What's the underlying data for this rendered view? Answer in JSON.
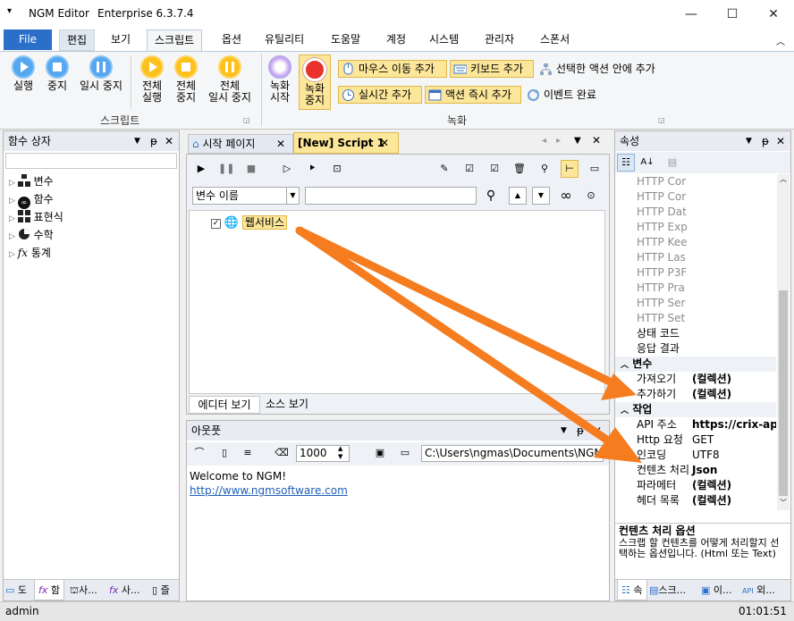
{
  "window": {
    "app_title": "NGM Editor",
    "edition": "Enterprise 6.3.7.4"
  },
  "ribbon_tabs": [
    "File",
    "편집",
    "보기",
    "스크립트",
    "옵션",
    "유틸리티",
    "도움말",
    "계정",
    "시스템",
    "관리자",
    "스폰서"
  ],
  "script_group": {
    "run": "실행",
    "stop": "중지",
    "pause": "일시 중지",
    "all_run_1": "전체",
    "all_run_2": "실행",
    "all_stop_1": "전체",
    "all_stop_2": "중지",
    "all_pause_1": "전체",
    "all_pause_2": "일시 중지",
    "label": "스크립트"
  },
  "record_group": {
    "rec_start_1": "녹화",
    "rec_start_2": "시작",
    "rec_stop_1": "녹화",
    "rec_stop_2": "중지",
    "mouse_move": "마우스 이동 추가",
    "keyboard": "키보드 추가",
    "add_in_action": "선택한 액션 안에 추가",
    "realtime": "실시간 추가",
    "action_now": "액션 즉시 추가",
    "event_done": "이벤트 완료",
    "label": "녹화"
  },
  "func_box": {
    "title": "함수 상자",
    "items": [
      "변수",
      "함수",
      "표현식",
      "수학",
      "통계"
    ]
  },
  "bottom_tabs": [
    "도",
    "함",
    "사...",
    "사...",
    "즐"
  ],
  "doc_tabs": {
    "start_page": "시작 페이지",
    "script": "[New] Script 1"
  },
  "editor": {
    "var_select": "변수 이름",
    "web_node": "웹서비스",
    "editor_view": "에디터 보기",
    "source_view": "소스 보기"
  },
  "output": {
    "title": "아웃풋",
    "count": "1000",
    "path": "C:\\Users\\ngmas\\Documents\\NGM\\",
    "welcome": "Welcome to NGM!",
    "link": "http://www.ngmsoftware.com"
  },
  "properties": {
    "title": "속성",
    "gray_rows": [
      "HTTP Cor",
      "HTTP Cor",
      "HTTP Dat",
      "HTTP Exp",
      "HTTP Kee",
      "HTTP Las",
      "HTTP P3F",
      "HTTP Pra",
      "HTTP Ser",
      "HTTP Set"
    ],
    "rows_top": [
      "상태 코드",
      "응답 결과"
    ],
    "cat_var": "변수",
    "fetch_k": "가져오기",
    "fetch_v": "(컬렉션)",
    "add_k": "추가하기",
    "add_v": "(컬렉션)",
    "cat_task": "작업",
    "api_k": "API 주소",
    "api_v": "https://crix-ap",
    "http_k": "Http 요청",
    "http_v": "GET",
    "enc_k": "인코딩",
    "enc_v": "UTF8",
    "content_k": "컨텐츠 처리",
    "content_v": "Json",
    "param_k": "파라메터",
    "param_v": "(컬렉션)",
    "header_k": "헤더 목록",
    "header_v": "(컬렉션)",
    "desc_title": "컨텐츠 처리 옵션",
    "desc_text": "스크랩 할 컨텐츠를 어떻게 처리할지 선택하는 옵션입니다. (Html 또는 Text)",
    "bottom_tabs": [
      "속",
      "스크...",
      "이...",
      "외..."
    ]
  },
  "status": {
    "user": "admin",
    "time": "01:01:51"
  },
  "colors": {
    "accent": "#2b6fc9",
    "arrow": "#f57c1f",
    "highlight": "#fce69a"
  }
}
